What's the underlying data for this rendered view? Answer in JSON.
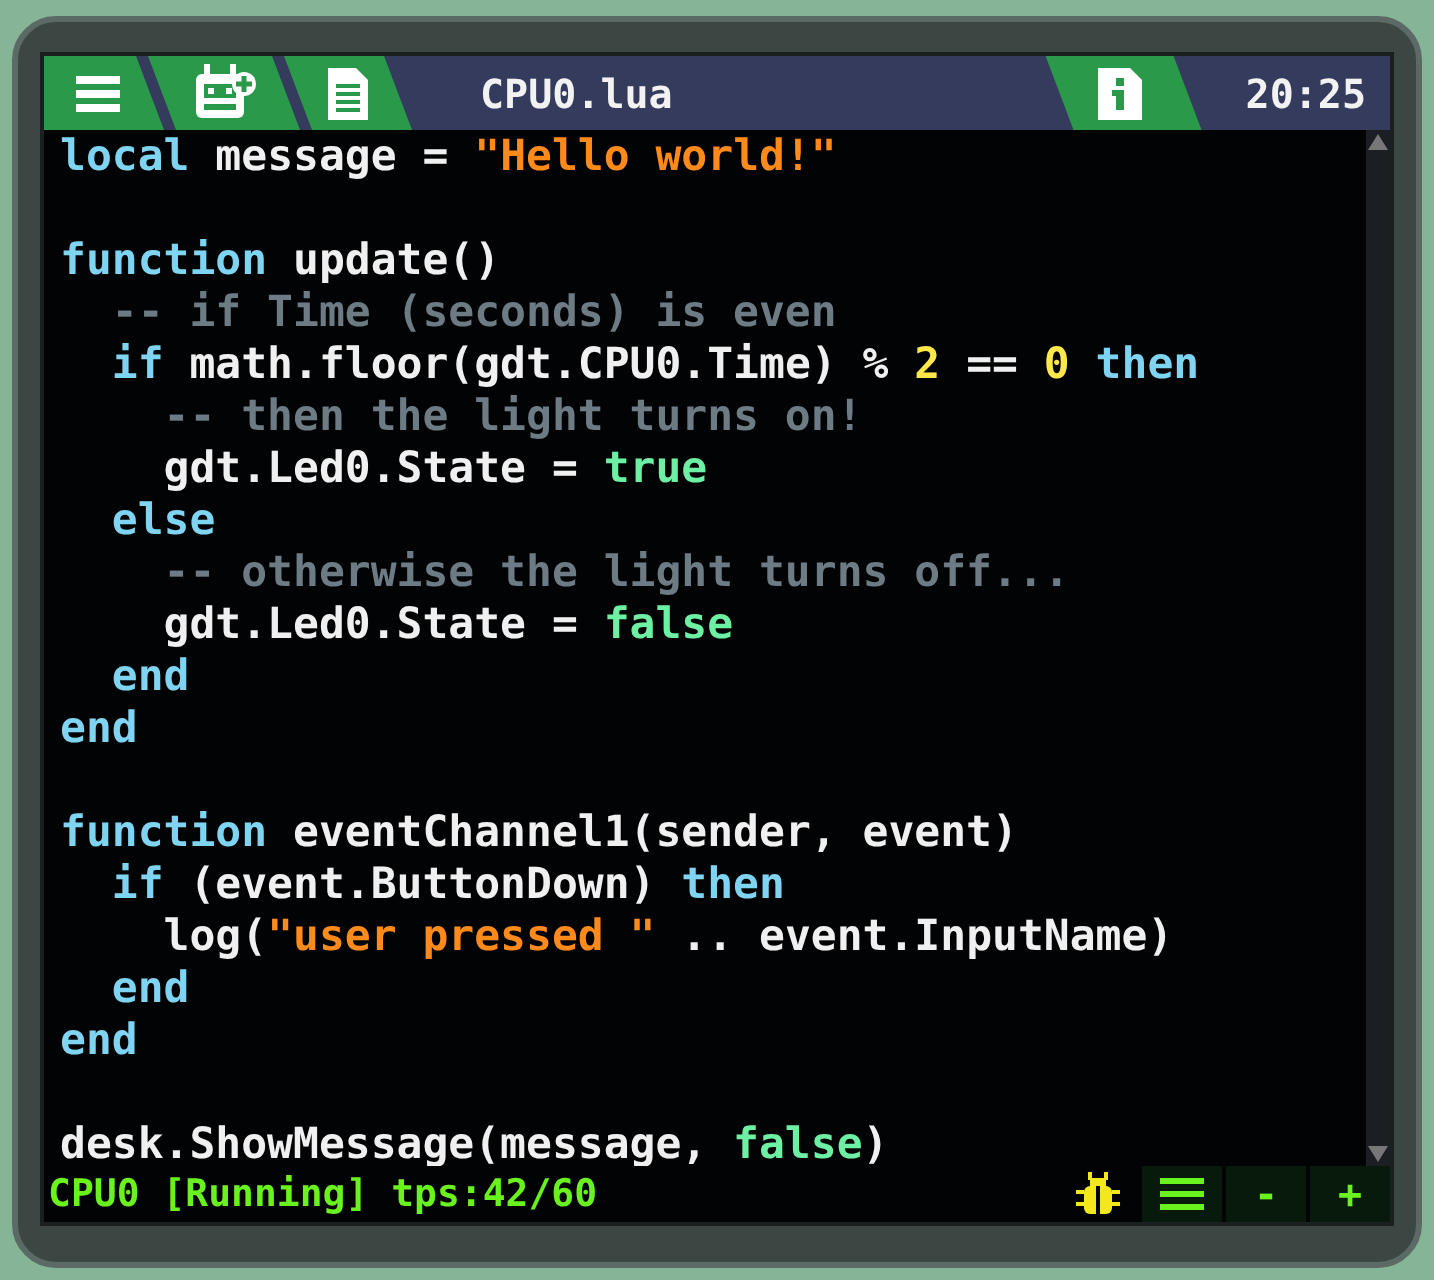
{
  "tabs": [
    {
      "kind": "menu",
      "selected": true
    },
    {
      "kind": "gadget",
      "selected": true
    },
    {
      "kind": "document",
      "selected": true
    }
  ],
  "file_title": "CPU0.lua",
  "info_tab": {
    "selected": true
  },
  "clock": "20:25",
  "code": [
    {
      "kind": "code",
      "tokens": [
        {
          "kind": "keyword",
          "text": "local"
        },
        {
          "kind": "plain",
          "text": " message = "
        },
        {
          "kind": "string",
          "text": "\"Hello world!\""
        }
      ]
    },
    {
      "kind": "blank"
    },
    {
      "kind": "code",
      "tokens": [
        {
          "kind": "keyword",
          "text": "function"
        },
        {
          "kind": "plain",
          "text": " update()"
        }
      ]
    },
    {
      "kind": "code",
      "tokens": [
        {
          "kind": "comment",
          "text": "  -- if Time (seconds) is even"
        }
      ]
    },
    {
      "kind": "code",
      "tokens": [
        {
          "kind": "keyword",
          "text": "  if"
        },
        {
          "kind": "plain",
          "text": " math.floor(gdt.CPU0.Time) % "
        },
        {
          "kind": "number",
          "text": "2"
        },
        {
          "kind": "plain",
          "text": " == "
        },
        {
          "kind": "number",
          "text": "0"
        },
        {
          "kind": "keyword",
          "text": " then"
        }
      ]
    },
    {
      "kind": "code",
      "tokens": [
        {
          "kind": "comment",
          "text": "    -- then the light turns on!"
        }
      ]
    },
    {
      "kind": "code",
      "tokens": [
        {
          "kind": "plain",
          "text": "    gdt.Led0.State = "
        },
        {
          "kind": "boolean",
          "text": "true"
        }
      ]
    },
    {
      "kind": "code",
      "tokens": [
        {
          "kind": "keyword",
          "text": "  else"
        }
      ]
    },
    {
      "kind": "code",
      "tokens": [
        {
          "kind": "comment",
          "text": "    -- otherwise the light turns off..."
        }
      ]
    },
    {
      "kind": "code",
      "tokens": [
        {
          "kind": "plain",
          "text": "    gdt.Led0.State = "
        },
        {
          "kind": "boolean",
          "text": "false"
        }
      ]
    },
    {
      "kind": "code",
      "tokens": [
        {
          "kind": "keyword",
          "text": "  end"
        }
      ]
    },
    {
      "kind": "code",
      "tokens": [
        {
          "kind": "keyword",
          "text": "end"
        }
      ]
    },
    {
      "kind": "blank"
    },
    {
      "kind": "code",
      "tokens": [
        {
          "kind": "keyword",
          "text": "function"
        },
        {
          "kind": "plain",
          "text": " eventChannel1(sender, event)"
        }
      ]
    },
    {
      "kind": "code",
      "tokens": [
        {
          "kind": "keyword",
          "text": "  if"
        },
        {
          "kind": "plain",
          "text": " (event.ButtonDown) "
        },
        {
          "kind": "keyword",
          "text": "then"
        }
      ]
    },
    {
      "kind": "code",
      "tokens": [
        {
          "kind": "plain",
          "text": "    log("
        },
        {
          "kind": "string",
          "text": "\"user pressed \""
        },
        {
          "kind": "plain",
          "text": " .. event.InputName)"
        }
      ]
    },
    {
      "kind": "code",
      "tokens": [
        {
          "kind": "keyword",
          "text": "  end"
        }
      ]
    },
    {
      "kind": "code",
      "tokens": [
        {
          "kind": "keyword",
          "text": "end"
        }
      ]
    },
    {
      "kind": "blank"
    },
    {
      "kind": "code",
      "tokens": [
        {
          "kind": "plain",
          "text": "desk.ShowMessage(message, "
        },
        {
          "kind": "boolean",
          "text": "false"
        },
        {
          "kind": "plain",
          "text": ")"
        }
      ]
    }
  ],
  "status": "CPU0 [Running] tps:42/60",
  "status_buttons": [
    {
      "kind": "bug"
    },
    {
      "kind": "list"
    },
    {
      "kind": "text",
      "label": "-"
    },
    {
      "kind": "text",
      "label": "+"
    }
  ]
}
